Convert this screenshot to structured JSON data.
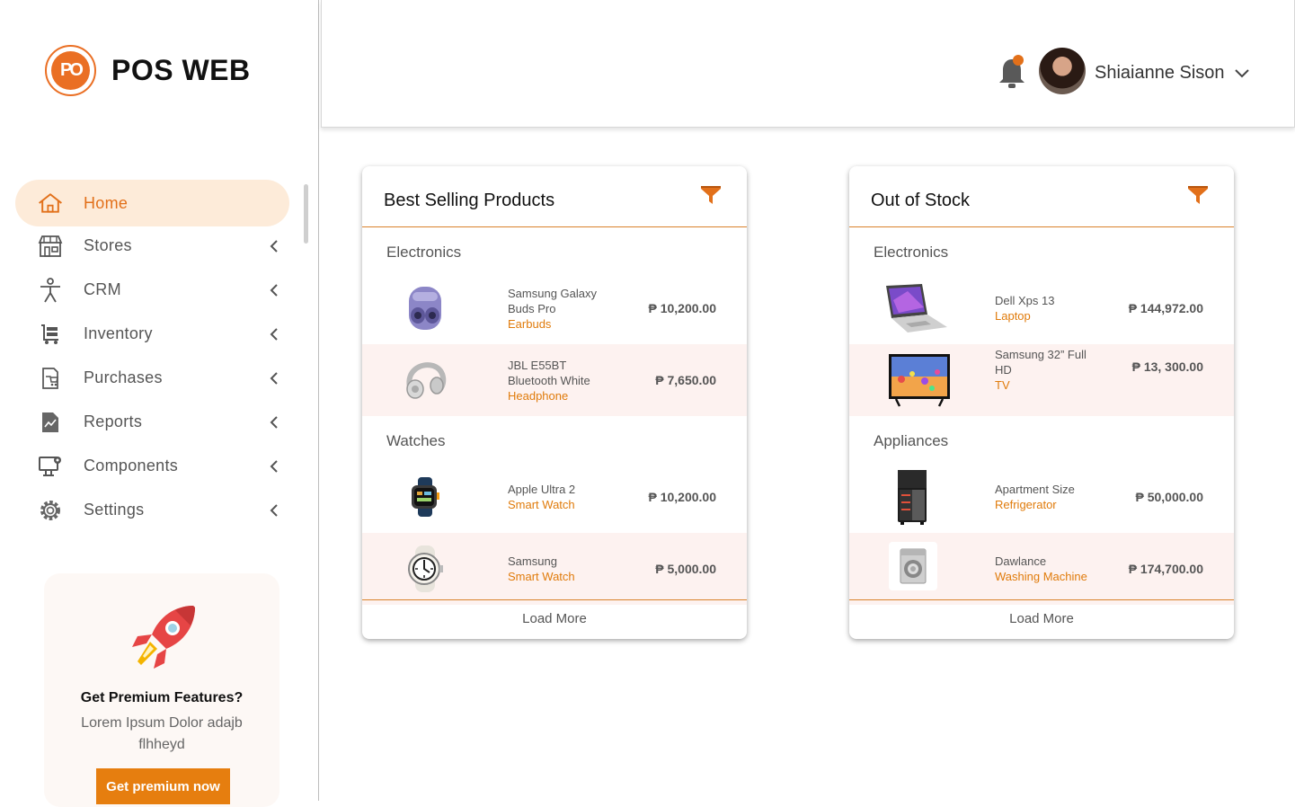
{
  "app": {
    "logo_mark_text": "PO",
    "title": "POS WEB",
    "accent": "#e2701a"
  },
  "sidebar": {
    "items": [
      {
        "label": "Home",
        "icon": "home-icon",
        "active": true
      },
      {
        "label": "Stores",
        "icon": "store-icon"
      },
      {
        "label": "CRM",
        "icon": "person-icon"
      },
      {
        "label": "Inventory",
        "icon": "cart-icon"
      },
      {
        "label": "Purchases",
        "icon": "receipt-icon"
      },
      {
        "label": "Reports",
        "icon": "report-icon"
      },
      {
        "label": "Components",
        "icon": "monitor-gear-icon"
      },
      {
        "label": "Settings",
        "icon": "gear-icon"
      }
    ]
  },
  "promo": {
    "title": "Get Premium Features?",
    "text": "Lorem Ipsum Dolor adajb flhheyd",
    "button": "Get premium now"
  },
  "header": {
    "user_name": "Shiaianne Sison",
    "notification_dot_color": "#e2701a"
  },
  "best_selling": {
    "title": "Best Selling Products",
    "groups": [
      {
        "category": "Electronics",
        "items": [
          {
            "name": "Samsung Galaxy Buds Pro",
            "type": "Earbuds",
            "price": "₱ 10,200.00",
            "icon": "earbuds-icon"
          },
          {
            "name": "JBL E55BT Bluetooth White",
            "type": "Headphone",
            "price": "₱ 7,650.00",
            "icon": "headphone-icon"
          }
        ]
      },
      {
        "category": "Watches",
        "items": [
          {
            "name": "Apple Ultra 2",
            "type": "Smart Watch",
            "price": "₱ 10,200.00",
            "icon": "smartwatch-icon"
          },
          {
            "name": "Samsung",
            "type": "Smart Watch",
            "price": "₱ 5,000.00",
            "icon": "watch-icon"
          }
        ]
      }
    ],
    "load_more": "Load More"
  },
  "out_of_stock": {
    "title": "Out of Stock",
    "groups": [
      {
        "category": "Electronics",
        "items": [
          {
            "name": "Dell Xps 13",
            "type": "Laptop",
            "price": "₱ 144,972.00",
            "icon": "laptop-icon"
          },
          {
            "name": "Samsung 32” Full HD",
            "type": "TV",
            "price": "₱ 13, 300.00",
            "icon": "tv-icon"
          }
        ]
      },
      {
        "category": "Appliances",
        "items": [
          {
            "name": "Apartment Size",
            "type": "Refrigerator",
            "price": "₱ 50,000.00",
            "icon": "refrigerator-icon"
          },
          {
            "name": "Dawlance",
            "type": "Washing Machine",
            "price": "₱ 174,700.00",
            "icon": "washing-machine-icon"
          }
        ]
      }
    ],
    "load_more": "Load More"
  }
}
